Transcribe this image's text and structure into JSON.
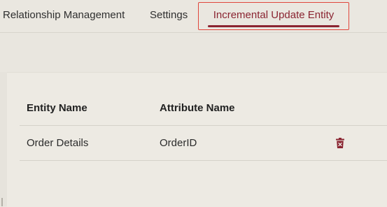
{
  "tabs": {
    "relationship": "Relationship Management",
    "settings": "Settings",
    "incremental": "Incremental Update Entity"
  },
  "table": {
    "headers": {
      "entity": "Entity Name",
      "attribute": "Attribute Name"
    },
    "rows": [
      {
        "entity": "Order Details",
        "attribute": "OrderID",
        "action_icon": "trash-icon"
      }
    ]
  },
  "colors": {
    "accent": "#8a2431",
    "highlight_border": "#e0463c",
    "background": "#ebe8e1"
  }
}
